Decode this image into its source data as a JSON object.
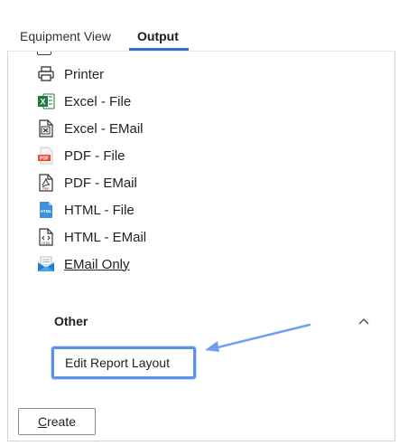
{
  "tabs": [
    {
      "label": "Equipment View"
    },
    {
      "label": "Output"
    }
  ],
  "output_items": [
    {
      "label": "Printer",
      "icon": "printer-icon"
    },
    {
      "label": "Excel  - File",
      "icon": "excel-file-icon"
    },
    {
      "label": "Excel - EMail",
      "icon": "excel-email-icon"
    },
    {
      "label": "PDF - File",
      "icon": "pdf-file-icon"
    },
    {
      "label": "PDF - EMail",
      "icon": "pdf-email-icon"
    },
    {
      "label": "HTML - File",
      "icon": "html-file-icon"
    },
    {
      "label": "HTML - EMail",
      "icon": "html-email-icon"
    },
    {
      "label": "EMail Only",
      "icon": "email-only-icon"
    }
  ],
  "other_section": {
    "title": "Other",
    "edit_report_label": "Edit Report Layout"
  },
  "create_button": {
    "first_letter": "C",
    "rest": "reate"
  },
  "colors": {
    "accent": "#2f73c7",
    "highlight_border": "#5b93e6",
    "annotation_arrow": "#6f9ff0",
    "excel_green": "#1d7a44",
    "pdf_red": "#e84b3c",
    "html_blue": "#3d8fe0",
    "email_blue": "#1d7fd1"
  }
}
